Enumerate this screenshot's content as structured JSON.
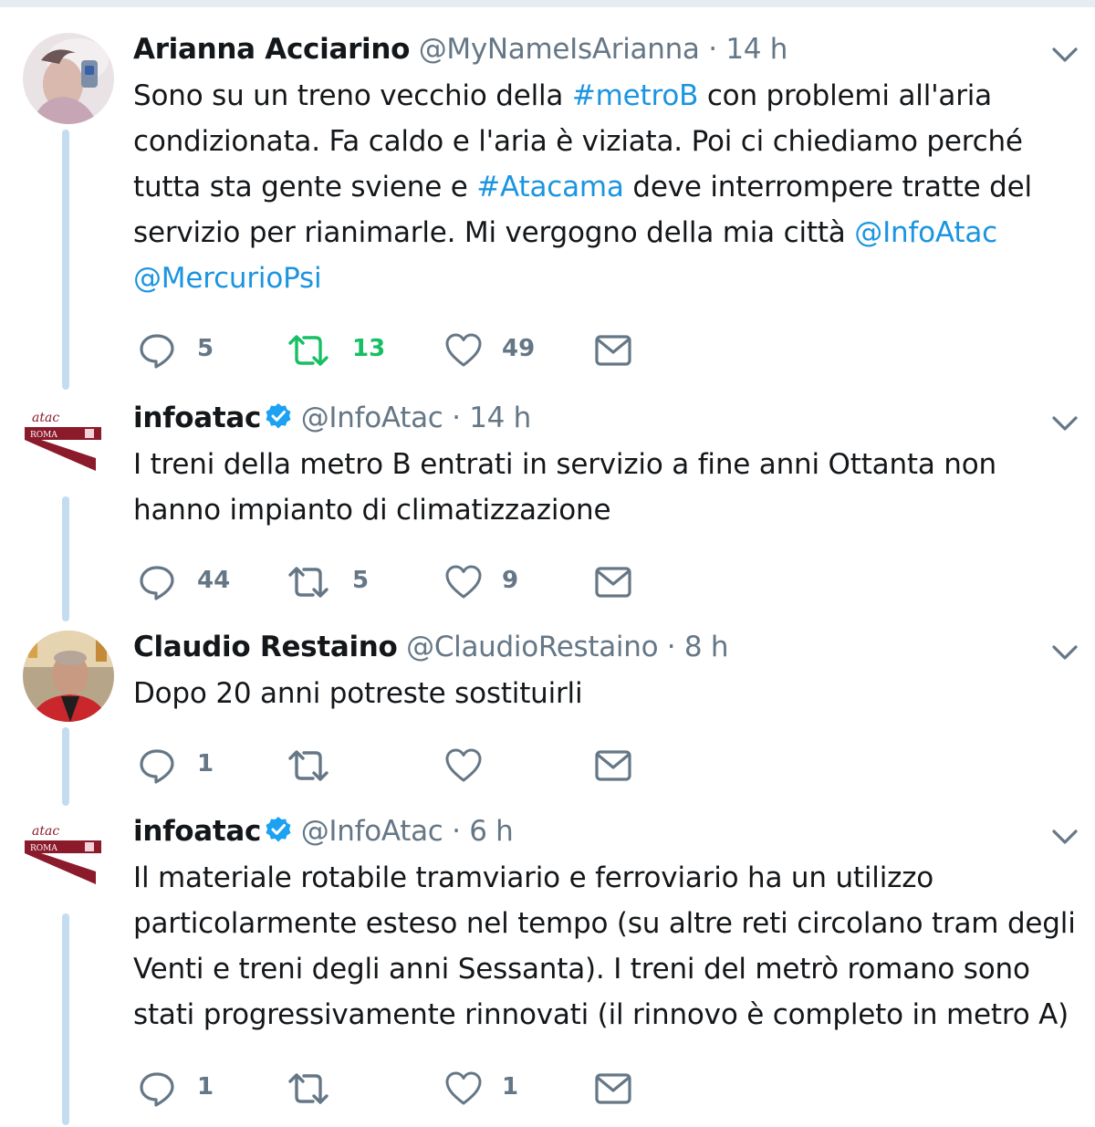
{
  "tweets": [
    {
      "name": "Arianna Acciarino",
      "handle": "@MyNameIsArianna",
      "separator": "·",
      "time": "14 h",
      "verified": false,
      "text_parts": {
        "p1": "Sono su un treno vecchio della ",
        "tag1": "#metroB",
        "p2": " con problemi all'aria condizionata. Fa caldo e l'aria è viziata. Poi ci chiediamo perché tutta sta gente sviene e ",
        "tag2": "#Atacama",
        "p3": " deve interrompere tratte del servizio per rianimarle. Mi vergogno della mia città ",
        "mention1": "@InfoAtac",
        "p4": " ",
        "mention2": "@MercurioPsi"
      },
      "replies": "5",
      "retweets": "13",
      "likes": "49"
    },
    {
      "name": "infoatac",
      "handle": "@InfoAtac",
      "separator": "·",
      "time": "14 h",
      "verified": true,
      "text": "I treni della metro B entrati in servizio a fine anni Ottanta non hanno impianto di climatizzazione",
      "replies": "44",
      "retweets": "5",
      "likes": "9"
    },
    {
      "name": "Claudio Restaino",
      "handle": "@ClaudioRestaino",
      "separator": "·",
      "time": "8 h",
      "verified": false,
      "text": "Dopo 20 anni potreste sostituirli",
      "replies": "1",
      "retweets": "",
      "likes": ""
    },
    {
      "name": "infoatac",
      "handle": "@InfoAtac",
      "separator": "·",
      "time": "6 h",
      "verified": true,
      "text": "Il materiale rotabile tramviario e ferroviario ha un utilizzo particolarmente esteso nel tempo (su altre reti circolano tram degli Venti e treni degli anni Sessanta). I treni del metrò romano sono stati progressivamente rinnovati (il rinnovo è completo in metro A)",
      "replies": "1",
      "retweets": "",
      "likes": "1"
    }
  ],
  "logo": {
    "brand": "atac",
    "city": "ROMA"
  },
  "colors": {
    "link": "#1b95e0",
    "muted": "#657786",
    "retweet_active": "#17bf63",
    "thread_line": "#c4dcf0",
    "verified": "#1da1f2",
    "atac_red": "#8b1a2b"
  },
  "icons": [
    "reply-icon",
    "retweet-icon",
    "like-icon",
    "direct-message-icon",
    "chevron-down-icon",
    "verified-badge-icon"
  ]
}
